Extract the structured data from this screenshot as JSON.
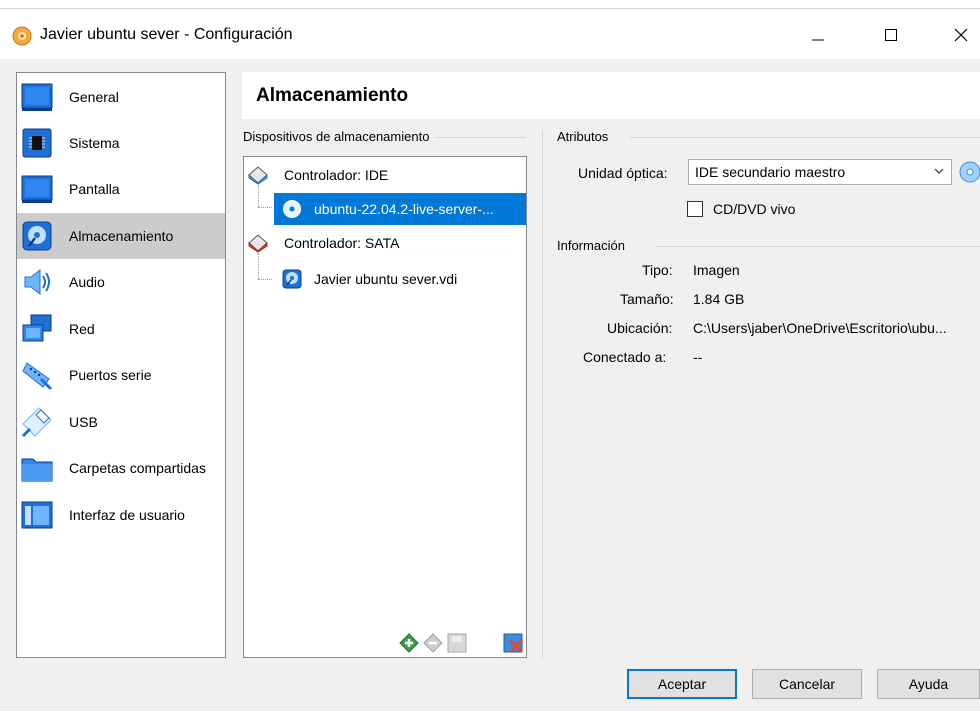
{
  "window": {
    "title": "Javier ubuntu sever - Configuración"
  },
  "sidebar": {
    "items": [
      {
        "label": "General",
        "icon": "general-icon"
      },
      {
        "label": "Sistema",
        "icon": "system-icon"
      },
      {
        "label": "Pantalla",
        "icon": "display-icon"
      },
      {
        "label": "Almacenamiento",
        "icon": "storage-icon",
        "selected": true
      },
      {
        "label": "Audio",
        "icon": "audio-icon"
      },
      {
        "label": "Red",
        "icon": "network-icon"
      },
      {
        "label": "Puertos serie",
        "icon": "serial-ports-icon"
      },
      {
        "label": "USB",
        "icon": "usb-icon"
      },
      {
        "label": "Carpetas compartidas",
        "icon": "shared-folders-icon"
      },
      {
        "label": "Interfaz de usuario",
        "icon": "user-interface-icon"
      }
    ]
  },
  "page": {
    "title": "Almacenamiento"
  },
  "storage": {
    "group_label": "Dispositivos de almacenamiento",
    "controllers": [
      {
        "label": "Controlador: IDE",
        "devices": [
          {
            "label": "ubuntu-22.04.2-live-server-...",
            "type": "optical",
            "selected": true
          }
        ]
      },
      {
        "label": "Controlador: SATA",
        "devices": [
          {
            "label": "Javier ubuntu sever.vdi",
            "type": "hard-disk",
            "selected": false
          }
        ]
      }
    ]
  },
  "attributes": {
    "group_label": "Atributos",
    "optical_drive_label": "Unidad óptica:",
    "optical_drive_value": "IDE secundario maestro",
    "live_cd_label": "CD/DVD vivo",
    "live_cd_checked": false
  },
  "information": {
    "group_label": "Información",
    "type_label": "Tipo:",
    "type_value": "Imagen",
    "size_label": "Tamaño:",
    "size_value": "1.84 GB",
    "location_label": "Ubicación:",
    "location_value": "C:\\Users\\jaber\\OneDrive\\Escritorio\\ubu...",
    "attached_label": "Conectado a:",
    "attached_value": "--"
  },
  "buttons": {
    "accept": "Aceptar",
    "cancel": "Cancelar",
    "help": "Ayuda"
  },
  "colors": {
    "selection": "#0078d7",
    "sidebar_selected": "#cccccc",
    "window_bg": "#f0f0f0"
  }
}
